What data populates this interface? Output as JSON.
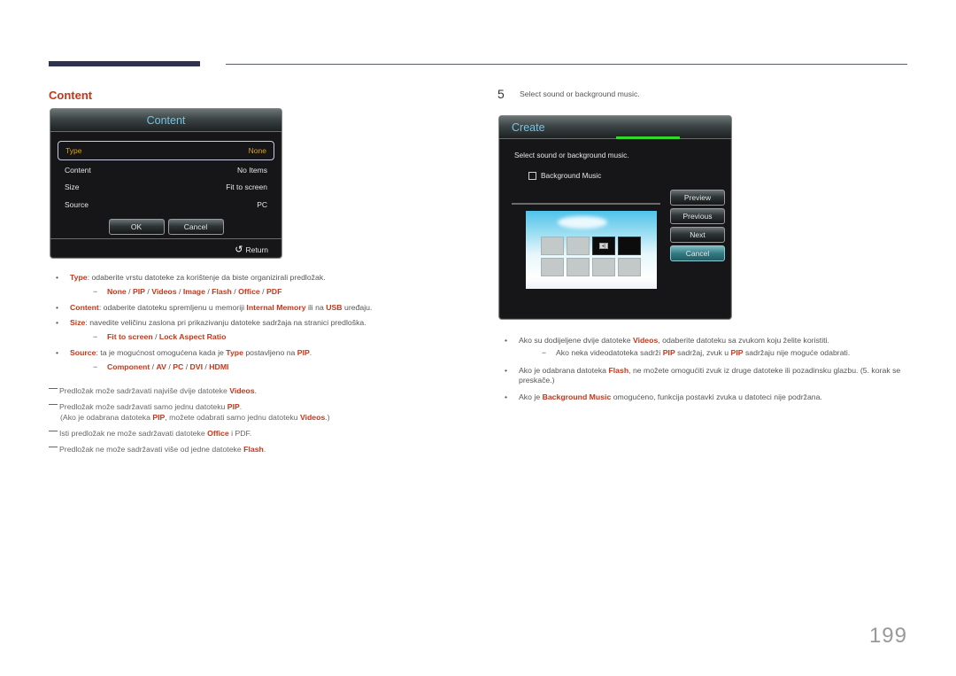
{
  "section_title": "Content",
  "content_dialog": {
    "title": "Content",
    "rows": [
      {
        "label": "Type",
        "value": "None"
      },
      {
        "label": "Content",
        "value": "No Items"
      },
      {
        "label": "Size",
        "value": "Fit to screen"
      },
      {
        "label": "Source",
        "value": "PC"
      }
    ],
    "ok_label": "OK",
    "cancel_label": "Cancel",
    "return_label": "Return",
    "return_icon": "return-arrow-icon"
  },
  "left_bullets": {
    "type": {
      "term": "Type",
      "text": ": odaberite vrstu datoteke za korištenje da biste organizirali predložak.",
      "options": [
        "None",
        "PIP",
        "Videos",
        "Image",
        "Flash",
        "Office",
        "PDF"
      ]
    },
    "content": {
      "term": "Content",
      "text1": ": odaberite datoteku spremljenu u memoriji ",
      "hl1": "Internal Memory",
      "text2": " ili na ",
      "hl2": "USB",
      "text3": " uređaju."
    },
    "size": {
      "term": "Size",
      "text": ": navedite veličinu zaslona pri prikazivanju datoteke sadržaja na stranici predloška.",
      "options": [
        "Fit to screen",
        "Lock Aspect Ratio"
      ]
    },
    "source": {
      "term": "Source",
      "text1": ": ta je mogućnost omogućena kada je ",
      "hl1": "Type",
      "text2": " postavljeno na ",
      "hl2": "PIP",
      "text3": ".",
      "options": [
        "Component",
        "AV",
        "PC",
        "DVI",
        "HDMI"
      ]
    }
  },
  "notes": [
    {
      "text1": "Predložak može sadržavati najviše dvije datoteke ",
      "hl1": "Videos",
      "text2": "."
    },
    {
      "text1": "Predložak može sadržavati samo jednu datoteku ",
      "hl1": "PIP",
      "text2": ".",
      "cont1": "(Ako je odabrana datoteka ",
      "cont_hl1": "PIP",
      "cont2": ", možete odabrati samo jednu datoteku ",
      "cont_hl2": "Videos",
      "cont3": ".)"
    },
    {
      "text1": "Isti predložak ne može sadržavati datoteke ",
      "hl1": "Office",
      "text2": " i PDF."
    },
    {
      "text1": "Predložak ne može sadržavati više od jedne datoteke ",
      "hl1": "Flash",
      "text2": "."
    }
  ],
  "step": {
    "number": "5",
    "text": "Select sound or background music."
  },
  "create_dialog": {
    "title": "Create",
    "progress_fraction": 1.0,
    "prompt": "Select sound or background music.",
    "checkbox_label": "Background Music",
    "checkbox_checked": false,
    "buttons": [
      "Preview",
      "Previous",
      "Next",
      "Cancel"
    ],
    "active_button": "Cancel",
    "sound_icon": "speaker-icon"
  },
  "right_bullets": {
    "b1": {
      "text1": "Ako su dodijeljene dvije datoteke ",
      "hl1": "Videos",
      "text2": ", odaberite datoteku sa zvukom koju želite koristiti.",
      "sub": {
        "text1": "Ako neka videodatoteka sadrži ",
        "hl1": "PIP",
        "text2": " sadržaj, zvuk u ",
        "hl2": "PIP",
        "text3": " sadržaju nije moguće odabrati."
      }
    },
    "b2": {
      "text1": "Ako je odabrana datoteka ",
      "hl1": "Flash",
      "text2": ", ne možete omogućiti zvuk iz druge datoteke ili pozadinsku glazbu. (5. korak se preskače.)"
    },
    "b3": {
      "text1": "Ako je ",
      "hl1": "Background Music",
      "text2": " omogućeno, funkcija postavki zvuka u datoteci nije podržana."
    }
  },
  "page_number": "199"
}
